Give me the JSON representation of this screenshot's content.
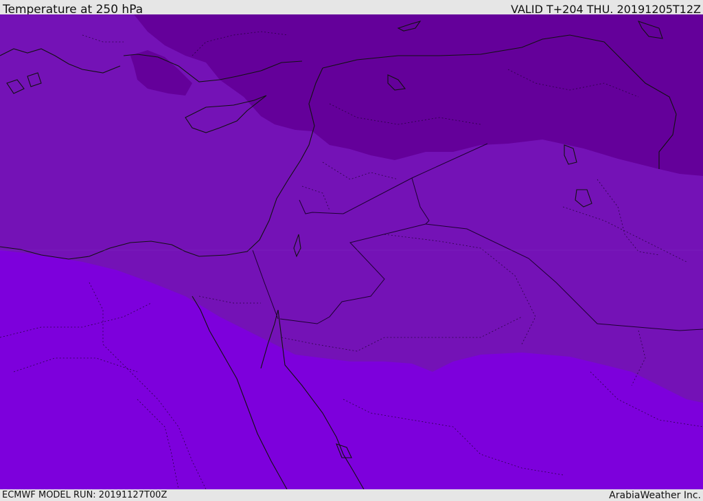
{
  "header": {
    "title": "Temperature at 250 hPa",
    "valid": "VALID T+204 THU. 20191205T12Z"
  },
  "footer": {
    "model_run": "ECMWF MODEL RUN: 20191127T00Z",
    "brand": "ArabiaWeather Inc."
  },
  "colors": {
    "band_dark": "#64009a",
    "band_mid": "#7412b6",
    "band_light": "#7d00dc",
    "coast": "#111111",
    "border": "#2a0040"
  }
}
